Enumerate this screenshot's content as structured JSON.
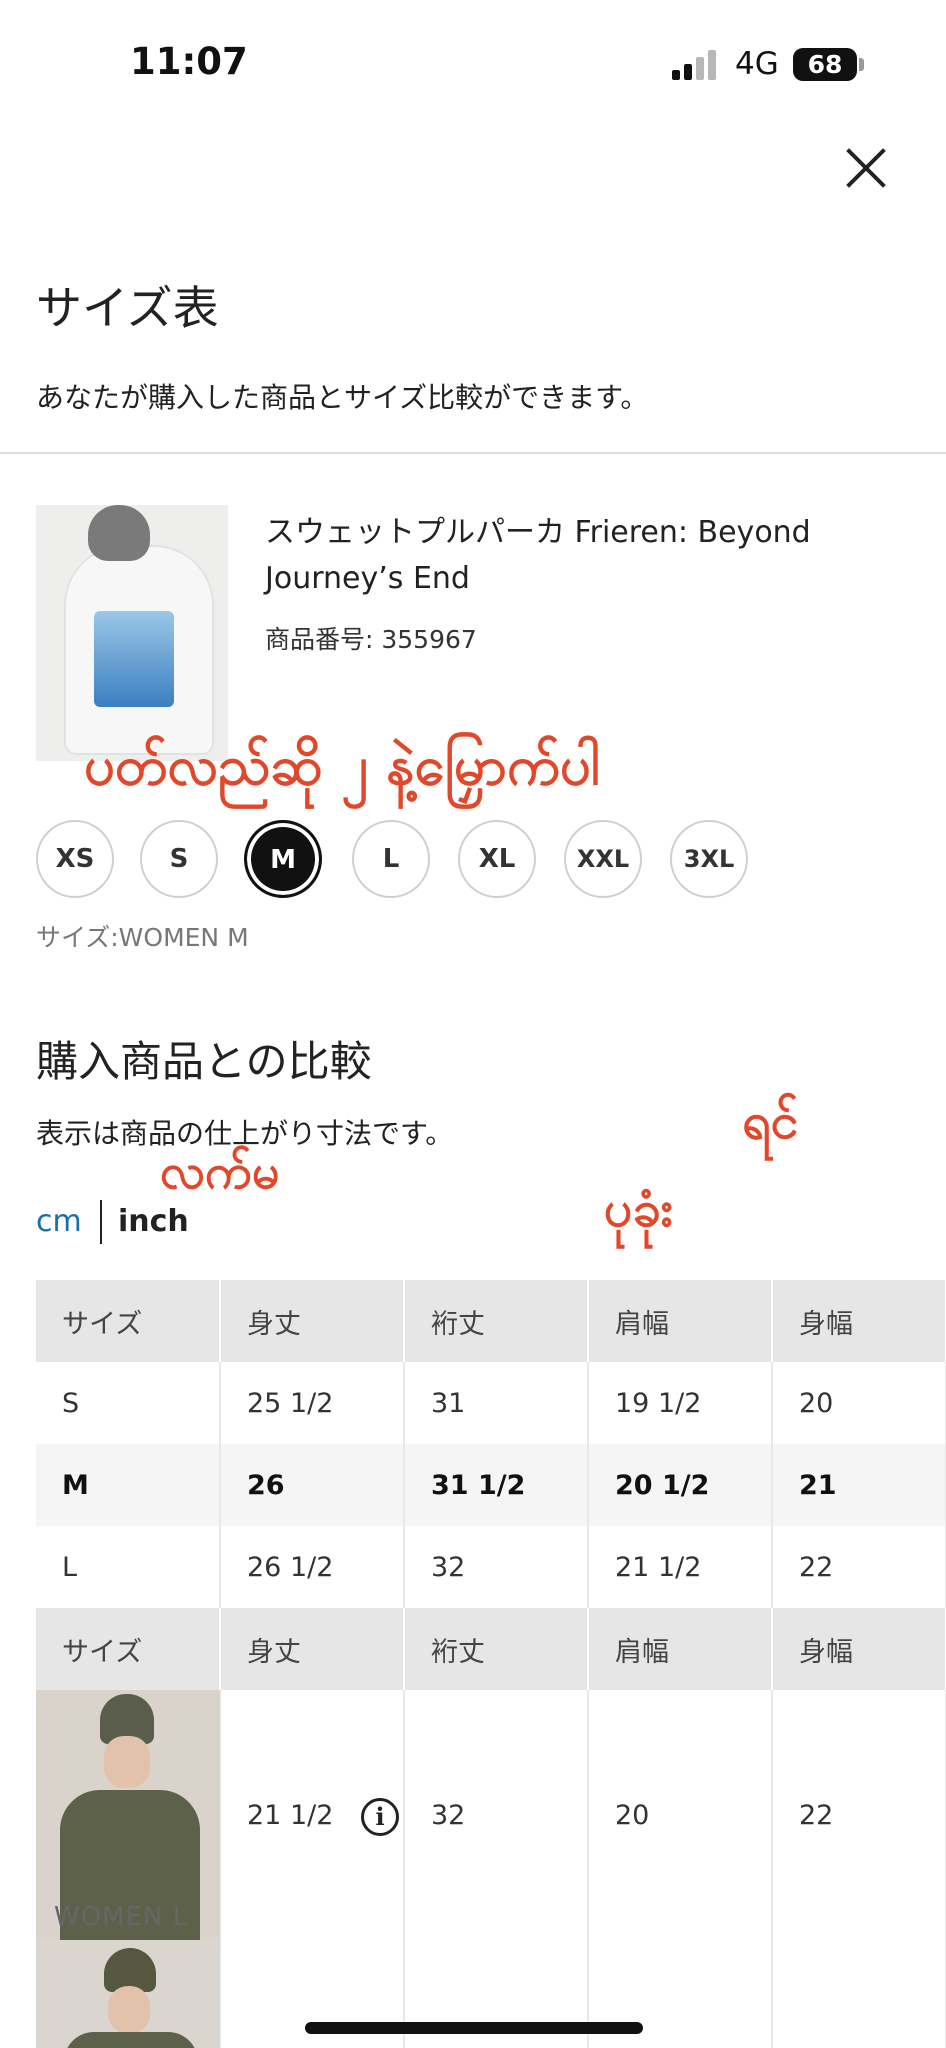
{
  "status_bar": {
    "time": "11:07",
    "network": "4G",
    "battery": "68"
  },
  "header": {
    "title": "サイズ表",
    "subtitle": "あなたが購入した商品とサイズ比較ができます。"
  },
  "product": {
    "name": "スウェットプルパーカ Frieren: Beyond Journey’s End",
    "code": "商品番号: 355967"
  },
  "sizes": {
    "options": [
      "XS",
      "S",
      "M",
      "L",
      "XL",
      "XXL",
      "3XL"
    ],
    "selected": "M",
    "caption": "サイズ:WOMEN M"
  },
  "comparison": {
    "title": "購入商品との比較",
    "note": "表示は商品の仕上がり寸法です。",
    "units": [
      "cm",
      "inch"
    ],
    "active_unit": "inch"
  },
  "table": {
    "headers": [
      "サイズ",
      "身丈",
      "裄丈",
      "肩幅",
      "身幅"
    ],
    "rows": [
      [
        "S",
        "25 1/2",
        "31",
        "19 1/2",
        "20"
      ],
      [
        "M",
        "26",
        "31 1/2",
        "20 1/2",
        "21"
      ],
      [
        "L",
        "26 1/2",
        "32",
        "21 1/2",
        "22"
      ]
    ],
    "compare_headers": [
      "サイズ",
      "身丈",
      "裄丈",
      "肩幅",
      "身幅"
    ],
    "compare_rows": [
      {
        "label": "WOMEN L",
        "values": [
          "21 1/2",
          "32",
          "20",
          "22"
        ]
      }
    ]
  },
  "annotations": {
    "a1": "ပတ်လည်ဆို ၂ နဲ့မြှောက်ပါ",
    "a2": "လက်မ",
    "a3": "ရင်",
    "a4": "ပုခုံး"
  },
  "colors": {
    "accent_link": "#1b6fa8",
    "annotation": "#e2472a",
    "selected_chip": "#111111"
  }
}
